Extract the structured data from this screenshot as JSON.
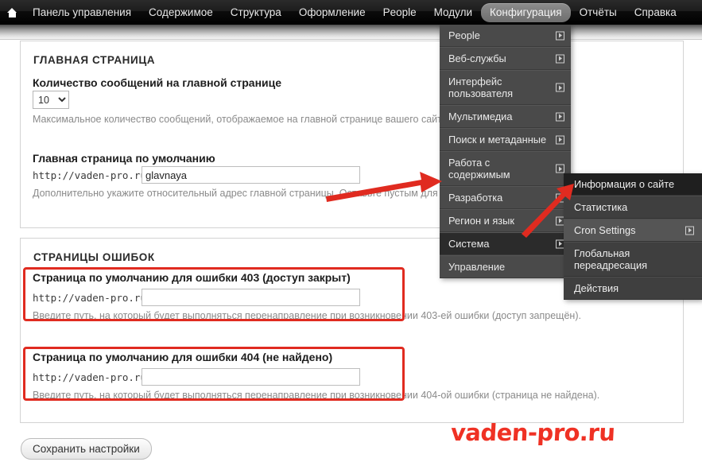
{
  "toolbar": {
    "home_icon": "home-icon",
    "items": [
      {
        "label": "Панель управления",
        "active": false
      },
      {
        "label": "Содержимое",
        "active": false
      },
      {
        "label": "Структура",
        "active": false
      },
      {
        "label": "Оформление",
        "active": false
      },
      {
        "label": "People",
        "active": false
      },
      {
        "label": "Модули",
        "active": false
      },
      {
        "label": "Конфигурация",
        "active": true
      },
      {
        "label": "Отчёты",
        "active": false
      },
      {
        "label": "Справка",
        "active": false
      }
    ]
  },
  "menu": {
    "items": [
      {
        "label": "People",
        "has_arrow": true,
        "selected": false
      },
      {
        "label": "Веб-службы",
        "has_arrow": true,
        "selected": false
      },
      {
        "label": "Интерфейс пользователя",
        "has_arrow": true,
        "selected": false
      },
      {
        "label": "Мультимедиа",
        "has_arrow": true,
        "selected": false
      },
      {
        "label": "Поиск и метаданные",
        "has_arrow": true,
        "selected": false
      },
      {
        "label": "Работа с содержимым",
        "has_arrow": true,
        "selected": false
      },
      {
        "label": "Разработка",
        "has_arrow": true,
        "selected": false
      },
      {
        "label": "Регион и язык",
        "has_arrow": true,
        "selected": false
      },
      {
        "label": "Система",
        "has_arrow": true,
        "selected": true
      },
      {
        "label": "Управление",
        "has_arrow": false,
        "selected": false
      }
    ]
  },
  "submenu": {
    "items": [
      {
        "label": "Информация о сайте",
        "has_arrow": false,
        "highlighted": false
      },
      {
        "label": "Статистика",
        "has_arrow": false,
        "highlighted": false
      },
      {
        "label": "Cron Settings",
        "has_arrow": true,
        "highlighted": true
      },
      {
        "label": "Глобальная переадресация",
        "has_arrow": false,
        "highlighted": false
      },
      {
        "label": "Действия",
        "has_arrow": false,
        "highlighted": false
      }
    ]
  },
  "front_page": {
    "section_title": "ГЛАВНАЯ СТРАНИЦА",
    "count_label": "Количество сообщений на главной странице",
    "count_value": "10",
    "count_options": [
      "10"
    ],
    "count_description": "Максимальное количество сообщений, отображаемое на главной странице вашего сайта.",
    "default_label": "Главная страница по умолчанию",
    "url_prefix": "http://vaden-pro.ru/",
    "default_value": "glavnaya",
    "default_description": "Дополнительно укажите относительный адрес главной страницы. Оставьте пустым для показа ленты содержания по умолчанию."
  },
  "error_pages": {
    "section_title": "СТРАНИЦЫ ОШИБОК",
    "url_prefix": "http://vaden-pro.ru/",
    "e403": {
      "label": "Страница по умолчанию для ошибки 403 (доступ закрыт)",
      "value": "",
      "description": "Введите путь, на который будет выполняться перенаправление при возникновении 403-ей ошибки (доступ запрещён)."
    },
    "e404": {
      "label": "Страница по умолчанию для ошибки 404 (не найдено)",
      "value": "",
      "description": "Введите путь, на который будет выполняться перенаправление при возникновении 404-ой ошибки (страница не найдена)."
    }
  },
  "save_label": "Сохранить настройки",
  "watermark": "vaden-pro.ru",
  "colors": {
    "toolbar_bg": "#101010",
    "menu_bg": "#4a4a4a",
    "submenu_bg": "#3f3f3f",
    "annotation_red": "#e02b20",
    "watermark_red": "#ef3124"
  }
}
